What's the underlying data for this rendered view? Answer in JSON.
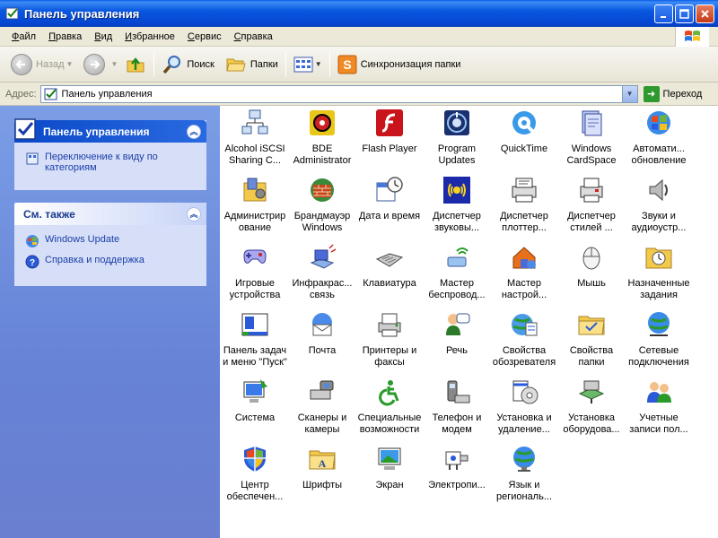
{
  "window": {
    "title": "Панель управления"
  },
  "menu": [
    {
      "u": "Ф",
      "rest": "айл"
    },
    {
      "u": "П",
      "rest": "равка"
    },
    {
      "u": "В",
      "rest": "ид"
    },
    {
      "u": "И",
      "rest": "збранное"
    },
    {
      "u": "С",
      "rest": "ервис"
    },
    {
      "u": "С",
      "rest": "правка"
    }
  ],
  "toolbar": {
    "back": "Назад",
    "search": "Поиск",
    "folders": "Папки",
    "sync": "Синхронизация папки"
  },
  "address": {
    "label": "Адрес:",
    "value": "Панель управления",
    "go": "Переход"
  },
  "leftpane": {
    "cp_title": "Панель управления",
    "switch_link": "Переключение к виду по категориям",
    "see_also_title": "См. также",
    "links": [
      "Windows Update",
      "Справка и поддержка"
    ]
  },
  "items": [
    {
      "label": "Alcohol iSCSI Sharing C...",
      "icon": "network-share-icon"
    },
    {
      "label": "BDE Administrator",
      "icon": "database-gear-icon"
    },
    {
      "label": "Flash Player",
      "icon": "flash-icon"
    },
    {
      "label": "Program Updates",
      "icon": "program-updates-icon"
    },
    {
      "label": "QuickTime",
      "icon": "quicktime-icon"
    },
    {
      "label": "Windows CardSpace",
      "icon": "cardspace-icon"
    },
    {
      "label": "Автомати... обновление",
      "icon": "windows-globe-icon"
    },
    {
      "label": "Администрир ование",
      "icon": "admin-tools-icon"
    },
    {
      "label": "Брандмауэр Windows",
      "icon": "firewall-icon"
    },
    {
      "label": "Дата и время",
      "icon": "date-time-icon"
    },
    {
      "label": "Диспетчер звуковы...",
      "icon": "sound-manager-icon"
    },
    {
      "label": "Диспетчер плоттер...",
      "icon": "plotter-icon"
    },
    {
      "label": "Диспетчер стилей ...",
      "icon": "style-manager-icon"
    },
    {
      "label": "Звуки и аудиоустр...",
      "icon": "speaker-icon"
    },
    {
      "label": "Игровые устройства",
      "icon": "gamepad-icon"
    },
    {
      "label": "Инфракрас... связь",
      "icon": "infrared-icon"
    },
    {
      "label": "Клавиатура",
      "icon": "keyboard-icon"
    },
    {
      "label": "Мастер беспровод...",
      "icon": "wireless-icon"
    },
    {
      "label": "Мастер настрой...",
      "icon": "network-wizard-icon"
    },
    {
      "label": "Мышь",
      "icon": "mouse-icon"
    },
    {
      "label": "Назначенные задания",
      "icon": "scheduled-tasks-icon"
    },
    {
      "label": "Панель задач и меню \"Пуск\"",
      "icon": "taskbar-icon"
    },
    {
      "label": "Почта",
      "icon": "mail-icon"
    },
    {
      "label": "Принтеры и факсы",
      "icon": "printer-icon"
    },
    {
      "label": "Речь",
      "icon": "speech-icon"
    },
    {
      "label": "Свойства обозревателя",
      "icon": "internet-options-icon"
    },
    {
      "label": "Свойства папки",
      "icon": "folder-options-icon"
    },
    {
      "label": "Сетевые подключения",
      "icon": "network-connections-icon"
    },
    {
      "label": "Система",
      "icon": "system-icon"
    },
    {
      "label": "Сканеры и камеры",
      "icon": "scanner-icon"
    },
    {
      "label": "Специальные возможности",
      "icon": "accessibility-icon"
    },
    {
      "label": "Телефон и модем",
      "icon": "phone-modem-icon"
    },
    {
      "label": "Установка и удаление...",
      "icon": "add-remove-icon"
    },
    {
      "label": "Установка оборудова...",
      "icon": "add-hardware-icon"
    },
    {
      "label": "Учетные записи пол...",
      "icon": "user-accounts-icon"
    },
    {
      "label": "Центр обеспечен...",
      "icon": "security-center-icon"
    },
    {
      "label": "Шрифты",
      "icon": "fonts-icon"
    },
    {
      "label": "Экран",
      "icon": "display-icon"
    },
    {
      "label": "Электропи...",
      "icon": "power-options-icon"
    },
    {
      "label": "Язык и региональ...",
      "icon": "language-icon"
    }
  ]
}
